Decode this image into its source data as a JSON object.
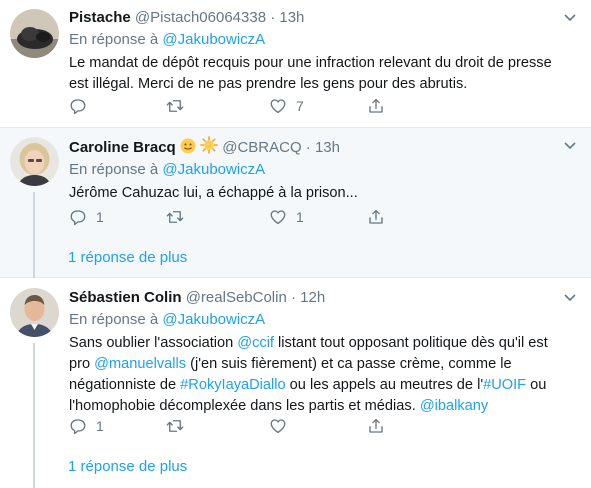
{
  "tweets": [
    {
      "name": "Pistache",
      "handle": "@Pistach06064338",
      "dot": "·",
      "time": "13h",
      "reply_prefix": "En réponse à ",
      "reply_user": "@JakubowiczA",
      "text_lines": [
        "Le mandat de dépôt recquis pour une infraction relevant du droit de presse",
        "est illégal. Merci de ne pas prendre les gens pour des abrutis."
      ],
      "replies": "",
      "retweets": "",
      "likes": "7"
    },
    {
      "name": "Caroline Bracq",
      "emojis": [
        "smiling-face-emoji",
        "sun-emoji"
      ],
      "handle": "@CBRACQ",
      "dot": "·",
      "time": "13h",
      "reply_prefix": "En réponse à ",
      "reply_user": "@JakubowiczA",
      "text_lines": [
        "Jérôme Cahuzac lui, a échappé à la prison..."
      ],
      "replies": "1",
      "retweets": "",
      "likes": "1",
      "more_replies": "1 réponse de plus"
    },
    {
      "name": "Sébastien Colin",
      "handle": "@realSebColin",
      "dot": "·",
      "time": "12h",
      "reply_prefix": "En réponse à ",
      "reply_user": "@JakubowiczA",
      "text": {
        "l1a": "Sans oublier l'association ",
        "l1m": "@ccif",
        "l1b": " listant tout opposant politique dès qu'il est",
        "l2a": "pro ",
        "l2m": "@manuelvalls",
        "l2b": " (j'en suis fièrement) et ca passe crème, comme le",
        "l3a": "négationniste de ",
        "l3m": "#RokyIayaDiallo",
        "l3b": " ou les appels au meutres de l'",
        "l3m2": "#UOIF",
        "l3c": " ou",
        "l4a": "l'homophobie décomplexée dans les partis et médias. ",
        "l4m": "@ibalkany"
      },
      "replies": "1",
      "retweets": "",
      "likes": "",
      "more_replies": "1 réponse de plus"
    }
  ],
  "colors": {
    "link": "#1da1f2",
    "muted": "#657786",
    "highlight_bg": "#f5f8fa",
    "thread_line": "#ccd6dd"
  },
  "icons": [
    "reply-icon",
    "retweet-icon",
    "like-icon",
    "share-icon",
    "chevron-down-icon"
  ]
}
